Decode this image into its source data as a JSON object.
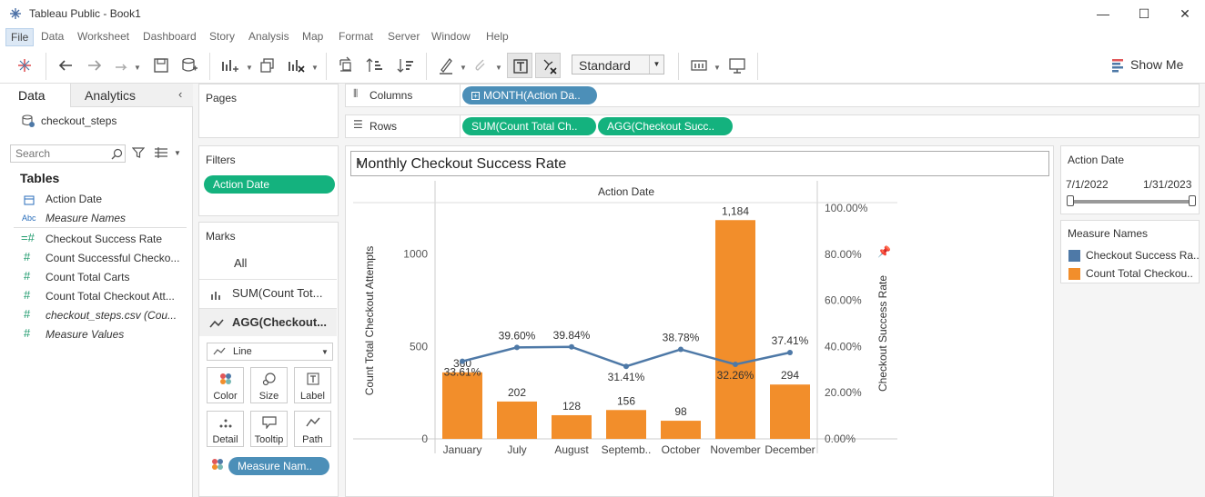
{
  "window": {
    "title": "Tableau Public - Book1",
    "minimize": "—",
    "maximize": "☐",
    "close": "✕"
  },
  "menu": [
    "File",
    "Data",
    "Worksheet",
    "Dashboard",
    "Story",
    "Analysis",
    "Map",
    "Format",
    "Server",
    "Window",
    "Help"
  ],
  "toolbar": {
    "fit_value": "Standard",
    "show_me_label": "Show Me"
  },
  "data_pane": {
    "tabs": [
      "Data",
      "Analytics"
    ],
    "datasource": "checkout_steps",
    "search_placeholder": "Search",
    "tables_heading": "Tables",
    "fields": [
      {
        "icon": "calendar-icon",
        "label": "Action Date",
        "italic": false,
        "type": "dimension"
      },
      {
        "icon": "abc-icon",
        "label": "Measure Names",
        "italic": true,
        "type": "dimension"
      },
      {
        "icon": "calc-measure-icon",
        "label": "Checkout Success Rate",
        "italic": false,
        "type": "measure"
      },
      {
        "icon": "measure-icon",
        "label": "Count Successful Checko...",
        "italic": false,
        "type": "measure"
      },
      {
        "icon": "measure-icon",
        "label": "Count Total Carts",
        "italic": false,
        "type": "measure"
      },
      {
        "icon": "measure-icon",
        "label": "Count Total Checkout Att...",
        "italic": false,
        "type": "measure"
      },
      {
        "icon": "measure-icon",
        "label": "checkout_steps.csv (Cou...",
        "italic": true,
        "type": "measure"
      },
      {
        "icon": "measure-icon",
        "label": "Measure Values",
        "italic": true,
        "type": "measure"
      }
    ]
  },
  "cards": {
    "pages_title": "Pages",
    "filters_title": "Filters",
    "filter_pill": "Action Date",
    "marks_title": "Marks",
    "marks_rows": [
      "All",
      "SUM(Count Tot...",
      "AGG(Checkout..."
    ],
    "mark_type": "Line",
    "mark_buttons": [
      "Color",
      "Size",
      "Label",
      "Detail",
      "Tooltip",
      "Path"
    ],
    "measure_names_pill": "Measure Nam.."
  },
  "shelves": {
    "columns_label": "Columns",
    "rows_label": "Rows",
    "columns_pill": "MONTH(Action Da..",
    "rows_pills": [
      "SUM(Count Total Ch..",
      "AGG(Checkout Succ.."
    ]
  },
  "view": {
    "sheet_title": "Monthly Checkout Success Rate"
  },
  "chart_data": {
    "type": "bar",
    "title": "",
    "header": "Action Date",
    "categories": [
      "January",
      "July",
      "August",
      "Septemb..",
      "October",
      "November",
      "December"
    ],
    "series": [
      {
        "name": "Count Total Checkou..",
        "type": "bar",
        "axis": "left",
        "values": [
          360,
          202,
          128,
          156,
          98,
          1184,
          294
        ],
        "labels": [
          "360",
          "202",
          "128",
          "156",
          "98",
          "1,184",
          "294"
        ],
        "color": "#f28e2b"
      },
      {
        "name": "Checkout Success Ra..",
        "type": "line",
        "axis": "right",
        "values": [
          0.3361,
          0.396,
          0.3984,
          0.3141,
          0.3878,
          0.3226,
          0.3741
        ],
        "labels": [
          "33.61%",
          "39.60%",
          "39.84%",
          "31.41%",
          "38.78%",
          "32.26%",
          "37.41%"
        ],
        "color": "#4e79a7"
      }
    ],
    "ylabel": "Count Total Checkout Attempts",
    "y2label": "Checkout Success Rate",
    "ylim": [
      0,
      1200
    ],
    "y_ticks": [
      0,
      500,
      1000
    ],
    "y_tick_labels": [
      "0",
      "500",
      "1000"
    ],
    "y2lim": [
      0,
      1.0
    ],
    "y2_ticks": [
      0,
      0.2,
      0.4,
      0.6,
      0.8,
      1.0
    ],
    "y2_tick_labels": [
      "0.00%",
      "20.00%",
      "40.00%",
      "60.00%",
      "80.00%",
      "100.00%"
    ]
  },
  "right_pane": {
    "filter_card_title": "Action Date",
    "range_start": "7/1/2022",
    "range_end": "1/31/2023",
    "slider_start": 0.0,
    "slider_end": 1.0,
    "legend_title": "Measure Names",
    "legend": [
      {
        "label": "Checkout Success Ra..",
        "color": "#4e79a7"
      },
      {
        "label": "Count Total Checkou..",
        "color": "#f28e2b"
      }
    ]
  }
}
